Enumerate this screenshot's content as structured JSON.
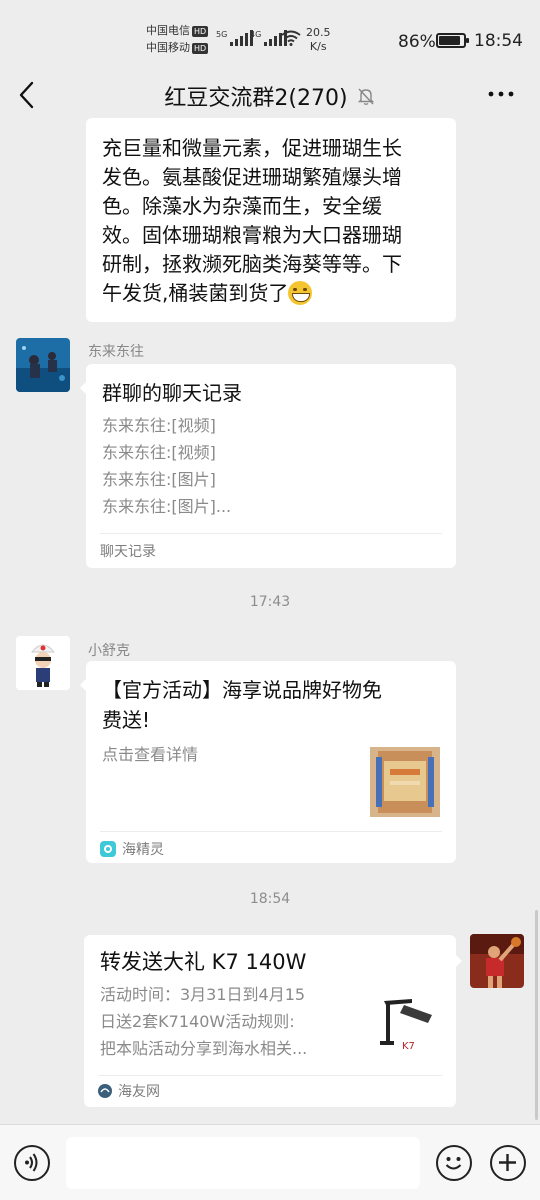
{
  "status_bar": {
    "carrier1": "中国电信",
    "carrier2": "中国移动",
    "hd": "HD",
    "net1": "5G",
    "net2": "4G",
    "speed_value": "20.5",
    "speed_unit": "K/s",
    "battery_percent": "86%",
    "battery_level": 0.86,
    "time": "18:54"
  },
  "header": {
    "title": "红豆交流群2(270)",
    "icons": [
      "back-icon",
      "mute-icon",
      "more-icon"
    ]
  },
  "messages": {
    "msg1": {
      "lines": [
        "充巨量和微量元素，促进珊瑚生长",
        "发色。氨基酸促进珊瑚繁殖爆头增",
        "色。除藻水为杂藻而生，安全缓",
        "效。固体珊瑚粮膏粮为大口器珊瑚",
        "研制，拯救濒死脑类海葵等等。下",
        "午发货,桶装菌到货了"
      ],
      "emoji": "grin-emoji"
    },
    "msg2": {
      "sender": "东来东往",
      "title": "群聊的聊天记录",
      "lines": [
        "东来东往:[视频]",
        "东来东往:[视频]",
        "东来东往:[图片]",
        "东来东往:[图片]..."
      ],
      "footer": "聊天记录"
    },
    "time1": "17:43",
    "msg3": {
      "sender": "小舒克",
      "title_line1": "【官方活动】海享说品牌好物免",
      "title_line2": "费送!",
      "desc": "点击查看详情",
      "footer": "海精灵"
    },
    "time2": "18:54",
    "msg4": {
      "title": "转发送大礼 K7 140W",
      "lines": [
        "活动时间：3月31日到4月15",
        "日送2套K7140W活动规则:",
        "把本贴活动分享到海水相关..."
      ],
      "footer": "海友网"
    }
  },
  "input_bar": {
    "icons": [
      "voice-icon",
      "emoji-icon",
      "plus-icon"
    ]
  },
  "colors": {
    "background": "#ededed",
    "bubble": "#ffffff",
    "text": "#191919",
    "meta_text": "#8d8d8d"
  }
}
